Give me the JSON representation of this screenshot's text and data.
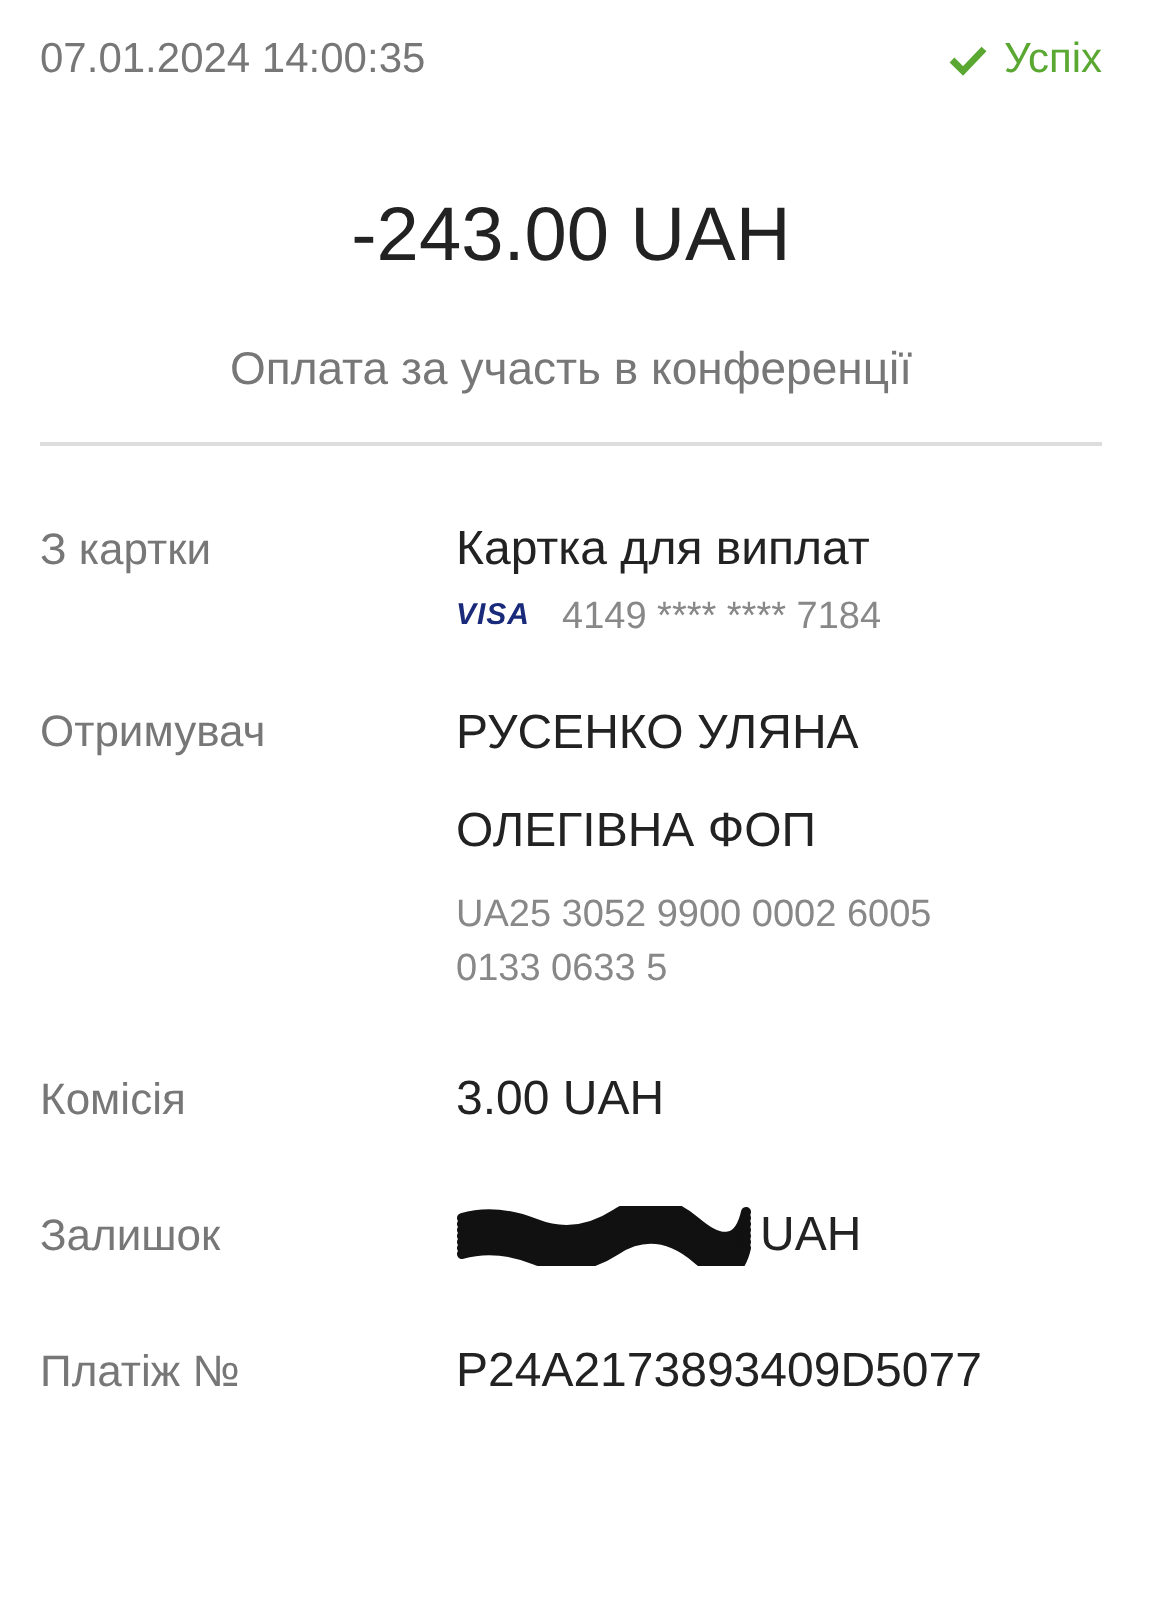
{
  "header": {
    "datetime": "07.01.2024 14:00:35",
    "status": {
      "label": "Успіх",
      "kind": "success"
    }
  },
  "amount": "-243.00 UAH",
  "description": "Оплата за участь в конференції",
  "rows": [
    {
      "label": "З картки",
      "kind": "card",
      "value": "Картка для виплат",
      "card_brand": "VISA",
      "card_number": "4149 **** **** 7184"
    },
    {
      "label": "Отримувач",
      "kind": "account",
      "value": "РУСЕНКО УЛЯНА ОЛЕГІВНА ФОП",
      "account": "UA25 3052 9900 0002 6005 0133 0633 5"
    },
    {
      "label": "Комісія",
      "kind": "text",
      "value": "3.00 UAH"
    },
    {
      "label": "Залишок",
      "kind": "redacted",
      "value": "UAH"
    },
    {
      "label": "Платіж №",
      "kind": "text",
      "value": "P24A2173893409D5077"
    }
  ]
}
